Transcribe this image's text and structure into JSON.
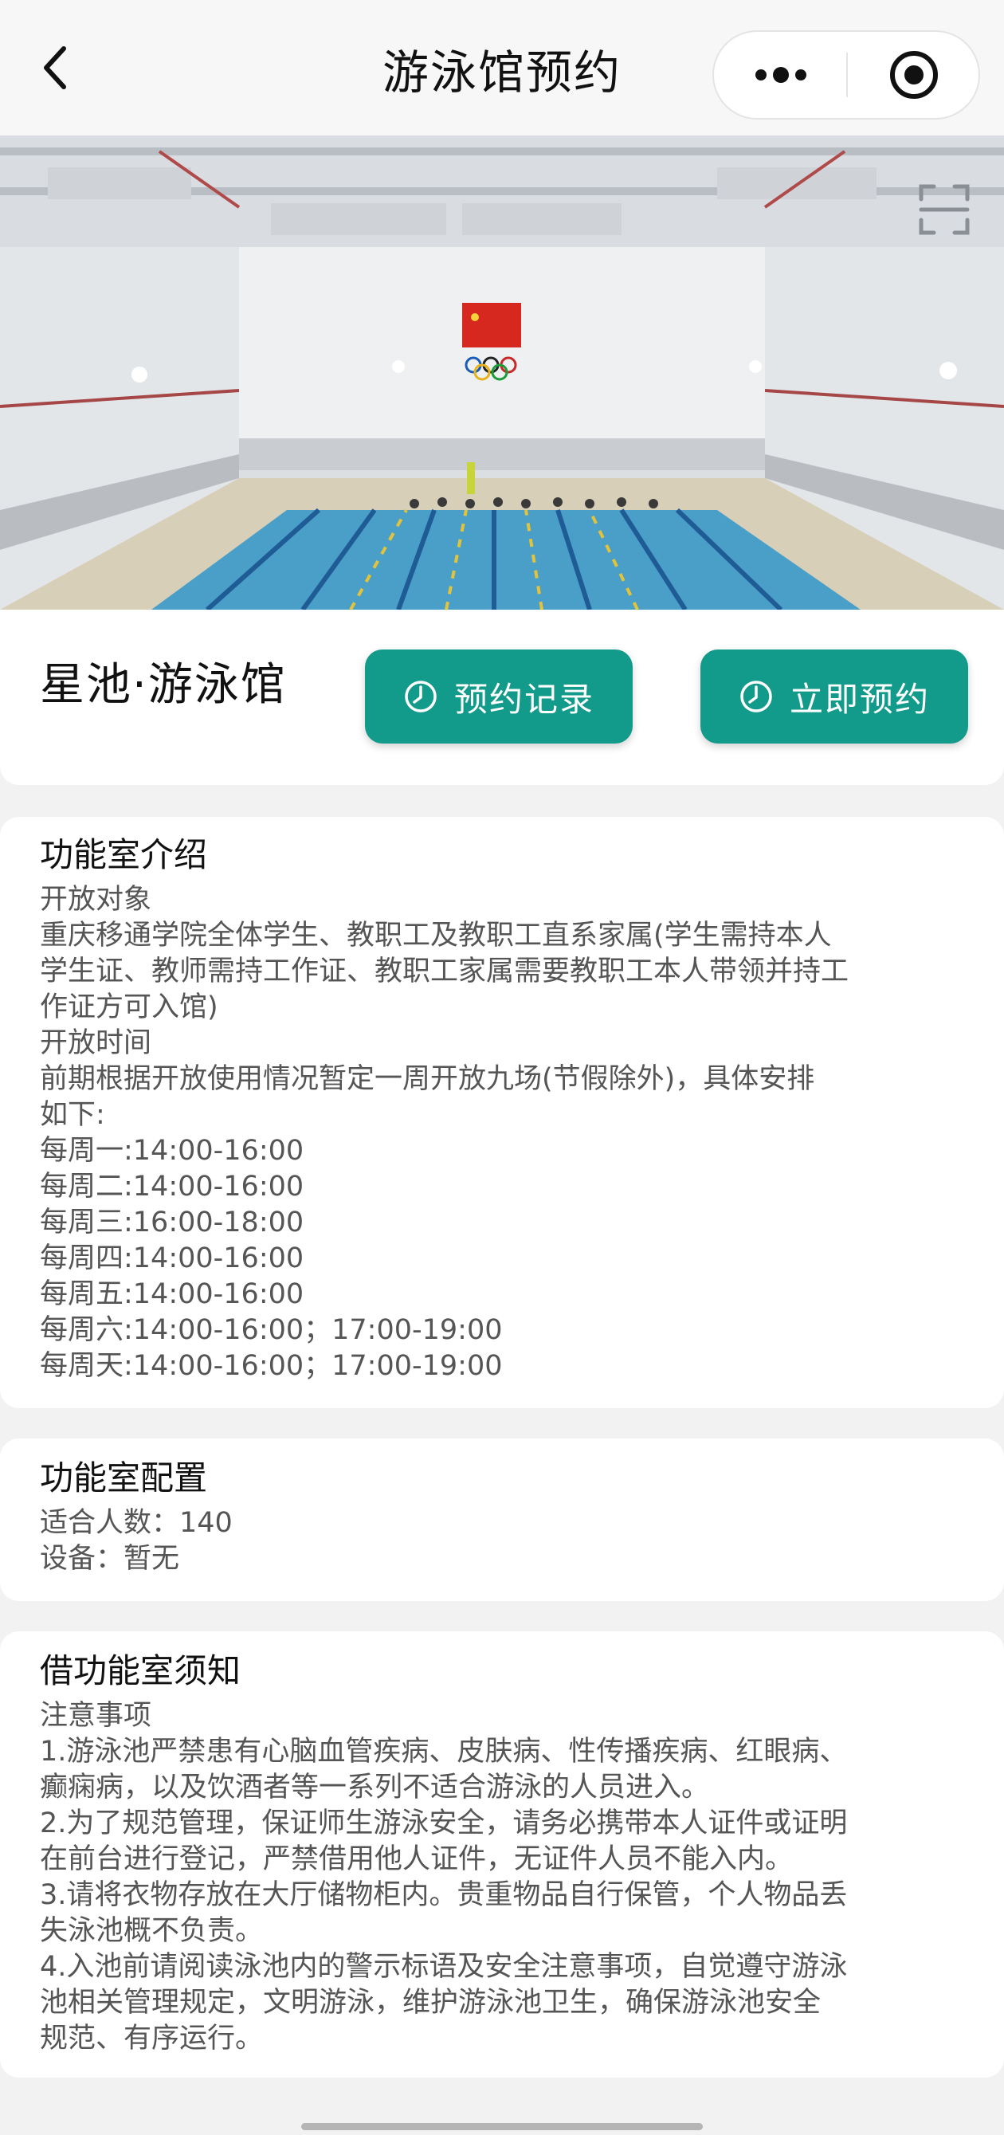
{
  "nav": {
    "title": "游泳馆预约",
    "back_icon": "chevron-left-icon",
    "more_icon": "more-dots-icon",
    "close_icon": "target-close-icon"
  },
  "hero": {
    "image": "indoor-swimming-pool-photo",
    "scan_icon": "scan-icon"
  },
  "header": {
    "venue_name": "星池·游泳馆",
    "records_button": "预约记录",
    "book_button": "立即预约",
    "button_icon": "clock-icon",
    "accent_color": "#129a8a"
  },
  "intro": {
    "title": "功能室介绍",
    "lines": [
      "开放对象",
      "重庆移通学院全体学生、教职工及教职工直系家属(学生需持本人",
      "学生证、教师需持工作证、教职工家属需要教职工本人带领并持工",
      "作证方可入馆)",
      "开放时间",
      "前期根据开放使用情况暂定一周开放九场(节假除外)，具体安排",
      "如下:",
      "每周一:14:00-16:00",
      "每周二:14:00-16:00",
      "每周三:16:00-18:00",
      "每周四:14:00-16:00",
      "每周五:14:00-16:00",
      "每周六:14:00-16:00；17:00-19:00",
      "每周天:14:00-16:00；17:00-19:00"
    ]
  },
  "config": {
    "title": "功能室配置",
    "capacity": "适合人数：140",
    "equipment": "设备：暂无"
  },
  "notice": {
    "title": "借功能室须知",
    "lines": [
      "注意事项",
      "1.游泳池严禁患有心脑血管疾病、皮肤病、性传播疾病、红眼病、",
      "癫痫病，以及饮酒者等一系列不适合游泳的人员进入。",
      "2.为了规范管理，保证师生游泳安全，请务必携带本人证件或证明",
      "在前台进行登记，严禁借用他人证件，无证件人员不能入内。",
      "3.请将衣物存放在大厅储物柜内。贵重物品自行保管，个人物品丢",
      "失泳池概不负责。",
      "4.入池前请阅读泳池内的警示标语及安全注意事项，自觉遵守游泳",
      "池相关管理规定，文明游泳，维护游泳池卫生，确保游泳池安全",
      "规范、有序运行。"
    ]
  }
}
